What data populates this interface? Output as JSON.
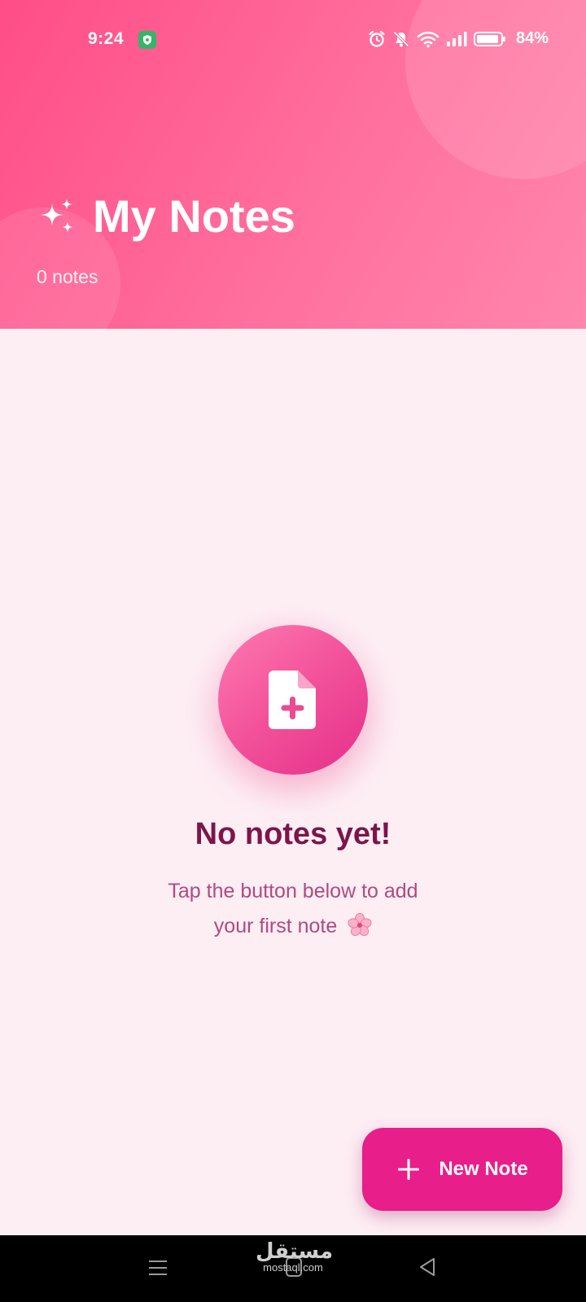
{
  "status_bar": {
    "time": "9:24",
    "battery": "84%",
    "icons": [
      "shield-icon",
      "alarm-icon",
      "bell-off-icon",
      "wifi-icon",
      "signal-icon",
      "battery-icon"
    ]
  },
  "header": {
    "title": "My Notes",
    "note_count": "0 notes",
    "icon": "sparkle-icon"
  },
  "empty_state": {
    "icon": "add-note-icon",
    "title": "No notes yet!",
    "subtitle_line1": "Tap the button below to add",
    "subtitle_line2": "your first note"
  },
  "fab": {
    "label": "New Note",
    "icon": "plus-icon"
  },
  "nav_bar": {
    "watermark_arabic": "مستقل",
    "watermark_latin": "mostaql.com",
    "icons": [
      "menu-icon",
      "home-icon",
      "back-icon"
    ]
  },
  "colors": {
    "header_start": "#ff4d88",
    "header_end": "#ff86ad",
    "background": "#fdeef4",
    "accent": "#e81e8a",
    "title_text": "#7b1649",
    "subtitle_text": "#b14a7f"
  }
}
